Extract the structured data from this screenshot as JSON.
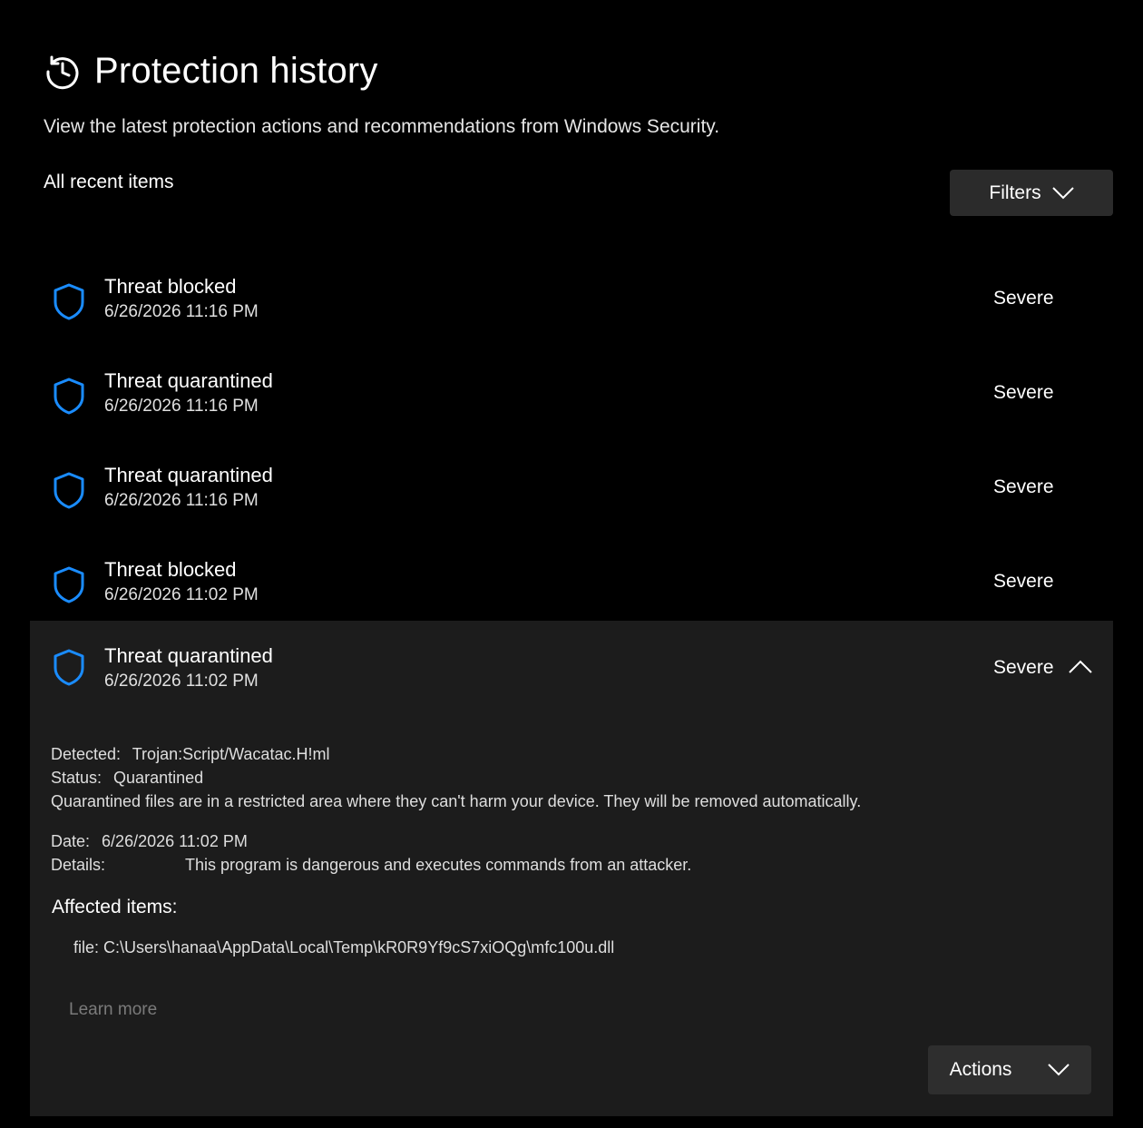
{
  "header": {
    "title": "Protection history",
    "subtitle": "View the latest protection actions and recommendations from Windows Security.",
    "section_label": "All recent items",
    "filters_label": "Filters"
  },
  "items": [
    {
      "title": "Threat blocked",
      "date": "6/26/2026 11:16 PM",
      "severity": "Severe"
    },
    {
      "title": "Threat quarantined",
      "date": "6/26/2026 11:16 PM",
      "severity": "Severe"
    },
    {
      "title": "Threat quarantined",
      "date": "6/26/2026 11:16 PM",
      "severity": "Severe"
    },
    {
      "title": "Threat blocked",
      "date": "6/26/2026 11:02 PM",
      "severity": "Severe"
    }
  ],
  "expanded_item": {
    "title": "Threat quarantined",
    "date": "6/26/2026 11:02 PM",
    "severity": "Severe",
    "detected_label": "Detected:",
    "detected_value": "Trojan:Script/Wacatac.H!ml",
    "status_label": "Status:",
    "status_value": "Quarantined",
    "status_note": "Quarantined files are in a restricted area where they can't harm your device. They will be removed automatically.",
    "date_label": "Date:",
    "date_value": "6/26/2026 11:02 PM",
    "details_label": "Details:",
    "details_value": "This program is dangerous and executes commands from an attacker.",
    "affected_heading": "Affected items:",
    "affected_file": "file: C:\\Users\\hanaa\\AppData\\Local\\Temp\\kR0R9Yf9cS7xiOQg\\mfc100u.dll",
    "learn_more": "Learn more",
    "actions_label": "Actions"
  },
  "icons": {
    "title": "history-icon",
    "item": "shield-icon",
    "filters": "chevron-down-icon",
    "collapse": "chevron-up-icon",
    "actions": "chevron-down-icon"
  },
  "colors": {
    "background": "#000000",
    "expanded_background": "#1c1c1c",
    "button_background": "#2b2b2b",
    "shield_accent": "#1a8cff",
    "link_muted": "#7a7a7a"
  }
}
